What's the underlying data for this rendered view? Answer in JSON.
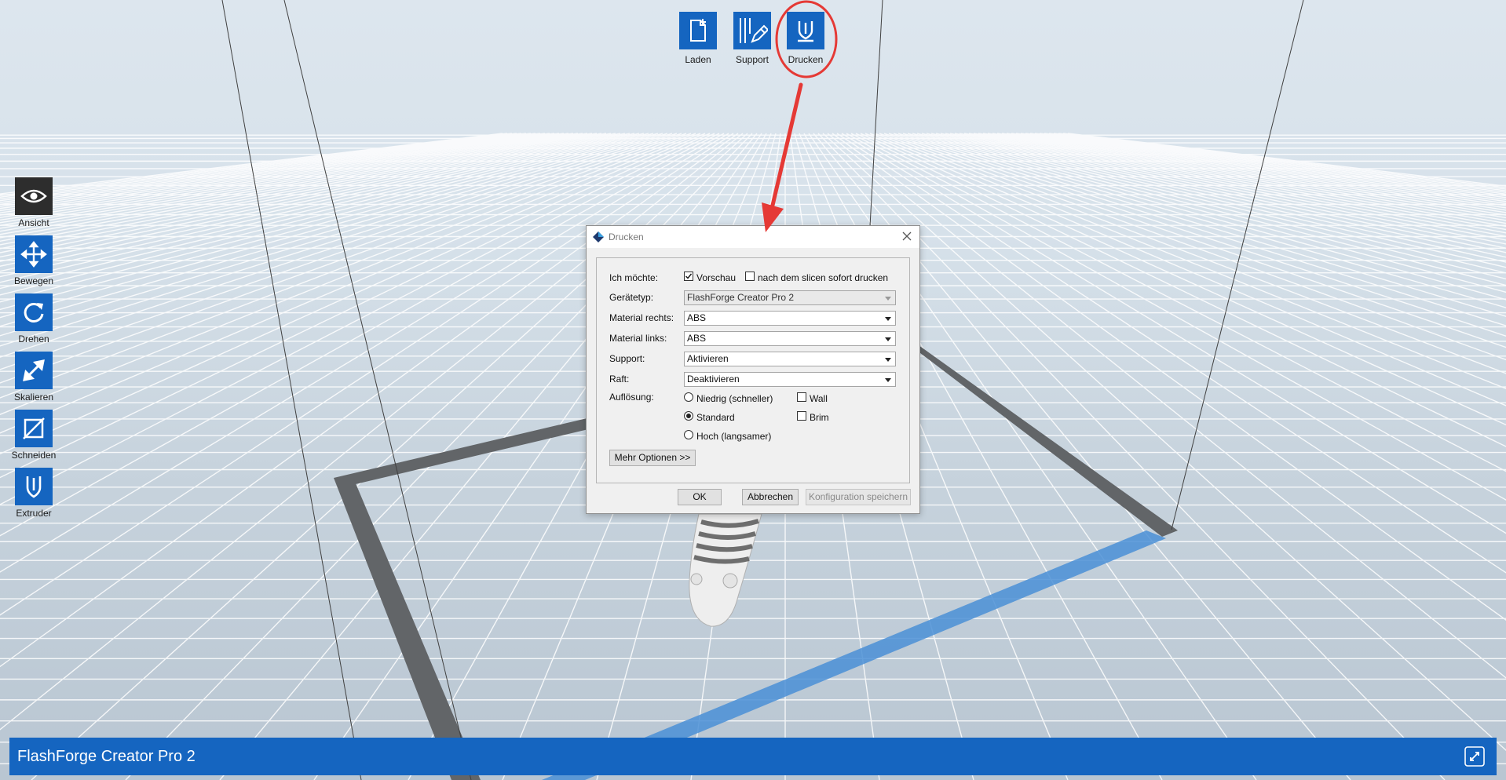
{
  "toolbar_top": {
    "items": [
      {
        "label": "Laden",
        "icon": "new-file-icon"
      },
      {
        "label": "Support",
        "icon": "support-pencil-icon"
      },
      {
        "label": "Drucken",
        "icon": "print-extruder-icon"
      }
    ]
  },
  "toolbar_left": {
    "items": [
      {
        "label": "Ansicht",
        "icon": "eye-icon"
      },
      {
        "label": "Bewegen",
        "icon": "move-arrows-icon"
      },
      {
        "label": "Drehen",
        "icon": "rotate-icon"
      },
      {
        "label": "Skalieren",
        "icon": "scale-arrow-icon"
      },
      {
        "label": "Schneiden",
        "icon": "cut-icon"
      },
      {
        "label": "Extruder",
        "icon": "extruder-icon"
      }
    ]
  },
  "statusbar": {
    "printer_name": "FlashForge Creator Pro 2",
    "icon": "link-icon"
  },
  "dialog": {
    "title": "Drucken",
    "want_label": "Ich möchte:",
    "preview_label": "Vorschau",
    "preview_checked": true,
    "print_immediately_label": "nach dem slicen sofort drucken",
    "print_immediately_checked": false,
    "device_type_label": "Gerätetyp:",
    "device_type_value": "FlashForge Creator Pro 2",
    "material_right_label": "Material rechts:",
    "material_right_value": "ABS",
    "material_left_label": "Material links:",
    "material_left_value": "ABS",
    "support_label": "Support:",
    "support_value": "Aktivieren",
    "raft_label": "Raft:",
    "raft_value": "Deaktivieren",
    "resolution_label": "Auflösung:",
    "resolution_low": "Niedrig (schneller)",
    "resolution_standard": "Standard",
    "resolution_high": "Hoch (langsamer)",
    "resolution_selected": "Standard",
    "wall_label": "Wall",
    "wall_checked": false,
    "brim_label": "Brim",
    "brim_checked": false,
    "more_options": "Mehr Optionen >>",
    "ok": "OK",
    "cancel": "Abbrechen",
    "save_config": "Konfiguration speichern"
  },
  "colors": {
    "accent": "#1565c0",
    "annotation": "#e53935",
    "highlight_band": "#4a8fd6"
  }
}
